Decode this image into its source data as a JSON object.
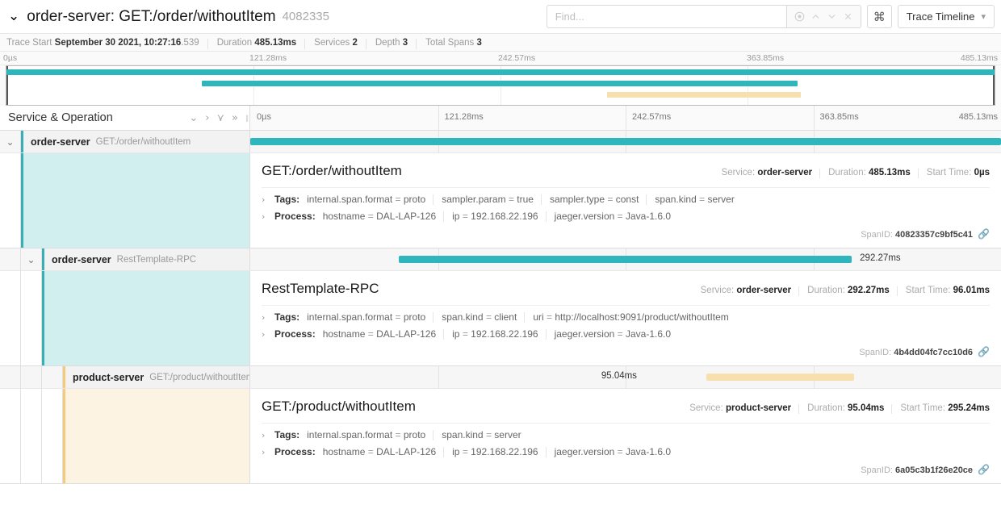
{
  "header": {
    "caret_icon": "chevron-down-icon",
    "title": "order-server: GET:/order/withoutItem",
    "trace_id": "4082335",
    "search_placeholder": "Find...",
    "search_value": "",
    "nav_icons": [
      "target-icon",
      "chevron-up-icon",
      "chevron-down-icon",
      "close-icon"
    ],
    "cmd_label": "⌘",
    "view_selector_label": "Trace Timeline",
    "view_selector_caret": "chevron-down-icon"
  },
  "summary": [
    {
      "label": "Trace Start",
      "value": "September 30 2021, 10:27:16",
      "value_faint": ".539"
    },
    {
      "label": "Duration",
      "value": "485.13ms",
      "value_faint": ""
    },
    {
      "label": "Services",
      "value": "2",
      "value_faint": ""
    },
    {
      "label": "Depth",
      "value": "3",
      "value_faint": ""
    },
    {
      "label": "Total Spans",
      "value": "3",
      "value_faint": ""
    }
  ],
  "ticks": [
    "0µs",
    "121.28ms",
    "242.57ms",
    "363.85ms",
    "485.13ms"
  ],
  "colors": {
    "teal": "#2eb6bc",
    "tan": "#f8dfae",
    "teal_accent": "#3aaeb5",
    "tan_accent": "#f5ca7b",
    "teal_bg": "#d2eff0",
    "tan_bg": "#fdf3e3"
  },
  "minimap": {
    "bars": [
      {
        "start_pct": 0,
        "width_pct": 100,
        "color": "#2eb6bc",
        "row": 0
      },
      {
        "start_pct": 19.8,
        "width_pct": 60.3,
        "color": "#2eb6bc",
        "row": 1
      },
      {
        "start_pct": 60.8,
        "width_pct": 19.6,
        "color": "#f8dfae",
        "row": 2
      }
    ]
  },
  "columns": {
    "left_header": "Service & Operation",
    "actions": [
      "chevron-down-icon",
      "chevron-right-icon",
      "double-chevron-down-icon",
      "double-chevron-right-icon"
    ]
  },
  "spans": [
    {
      "service": "order-server",
      "operation": "GET:/order/withoutItem",
      "depth": 0,
      "has_caret": true,
      "caret_icon": "chevron-down-icon",
      "accent": "teal",
      "bar": {
        "start_pct": 0,
        "width_pct": 100
      },
      "bar_label": "",
      "bar_label_pct": 0,
      "bar_label_side": "right",
      "detail": {
        "operation": "GET:/order/withoutItem",
        "service_label": "Service:",
        "service_value": "order-server",
        "duration_label": "Duration:",
        "duration_value": "485.13ms",
        "start_label": "Start Time:",
        "start_value": "0µs",
        "tags_label": "Tags:",
        "tags": [
          {
            "k": "internal.span.format",
            "v": "proto"
          },
          {
            "k": "sampler.param",
            "v": "true"
          },
          {
            "k": "sampler.type",
            "v": "const"
          },
          {
            "k": "span.kind",
            "v": "server"
          }
        ],
        "process_label": "Process:",
        "process": [
          {
            "k": "hostname",
            "v": "DAL-LAP-126"
          },
          {
            "k": "ip",
            "v": "192.168.22.196"
          },
          {
            "k": "jaeger.version",
            "v": "Java-1.6.0"
          }
        ],
        "spanid_label": "SpanID:",
        "spanid": "40823357c9bf5c41",
        "link_icon": "link-icon"
      }
    },
    {
      "service": "order-server",
      "operation": "RestTemplate-RPC",
      "depth": 1,
      "has_caret": true,
      "caret_icon": "chevron-down-icon",
      "accent": "teal",
      "bar": {
        "start_pct": 19.8,
        "width_pct": 60.3
      },
      "bar_label": "292.27ms",
      "bar_label_pct": 81.2,
      "bar_label_side": "right",
      "detail": {
        "operation": "RestTemplate-RPC",
        "service_label": "Service:",
        "service_value": "order-server",
        "duration_label": "Duration:",
        "duration_value": "292.27ms",
        "start_label": "Start Time:",
        "start_value": "96.01ms",
        "tags_label": "Tags:",
        "tags": [
          {
            "k": "internal.span.format",
            "v": "proto"
          },
          {
            "k": "span.kind",
            "v": "client"
          },
          {
            "k": "uri",
            "v": "http://localhost:9091/product/withoutItem"
          }
        ],
        "process_label": "Process:",
        "process": [
          {
            "k": "hostname",
            "v": "DAL-LAP-126"
          },
          {
            "k": "ip",
            "v": "192.168.22.196"
          },
          {
            "k": "jaeger.version",
            "v": "Java-1.6.0"
          }
        ],
        "spanid_label": "SpanID:",
        "spanid": "4b4dd04fc7cc10d6",
        "link_icon": "link-icon"
      }
    },
    {
      "service": "product-server",
      "operation": "GET:/product/withoutItem",
      "depth": 2,
      "has_caret": false,
      "caret_icon": "",
      "accent": "tan",
      "bar": {
        "start_pct": 60.8,
        "width_pct": 19.6
      },
      "bar_label": "95.04ms",
      "bar_label_pct": 51.5,
      "bar_label_side": "left",
      "detail": {
        "operation": "GET:/product/withoutItem",
        "service_label": "Service:",
        "service_value": "product-server",
        "duration_label": "Duration:",
        "duration_value": "95.04ms",
        "start_label": "Start Time:",
        "start_value": "295.24ms",
        "tags_label": "Tags:",
        "tags": [
          {
            "k": "internal.span.format",
            "v": "proto"
          },
          {
            "k": "span.kind",
            "v": "server"
          }
        ],
        "process_label": "Process:",
        "process": [
          {
            "k": "hostname",
            "v": "DAL-LAP-126"
          },
          {
            "k": "ip",
            "v": "192.168.22.196"
          },
          {
            "k": "jaeger.version",
            "v": "Java-1.6.0"
          }
        ],
        "spanid_label": "SpanID:",
        "spanid": "6a05c3b1f26e20ce",
        "link_icon": "link-icon"
      }
    }
  ]
}
